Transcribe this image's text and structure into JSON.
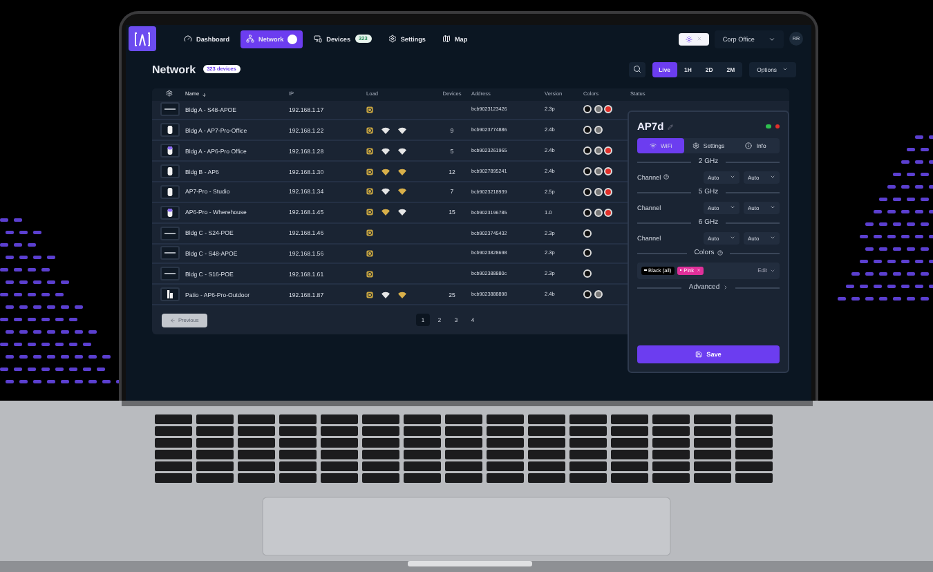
{
  "nav": {
    "items": [
      {
        "label": "Dashboard",
        "selected": false,
        "indicator": false
      },
      {
        "label": "Network",
        "selected": true,
        "indicator": true
      },
      {
        "label": "Devices",
        "selected": false,
        "indicator": false,
        "badge": "323"
      },
      {
        "label": "Settings",
        "selected": false,
        "indicator": false
      },
      {
        "label": "Map",
        "selected": false,
        "indicator": false
      }
    ],
    "theme_toggle": {
      "on": true
    },
    "org": "Corp Office",
    "avatar": "RR"
  },
  "page": {
    "title": "Network",
    "count": "323 devices",
    "ranges": [
      {
        "label": "Live",
        "selected": true
      },
      {
        "label": "1H",
        "selected": false
      },
      {
        "label": "2D",
        "selected": false
      },
      {
        "label": "2M",
        "selected": false
      }
    ],
    "options": "Options"
  },
  "table": {
    "columns": [
      {
        "label": "Name",
        "sorted": true
      },
      {
        "label": "IP",
        "sorted": false
      },
      {
        "label": "Load",
        "sorted": false
      },
      {
        "label": "Devices",
        "sorted": false
      },
      {
        "label": "Address",
        "sorted": false
      },
      {
        "label": "Version",
        "sorted": false
      },
      {
        "label": "Colors",
        "sorted": false
      },
      {
        "label": "Status",
        "sorted": false
      }
    ],
    "rows": [
      {
        "kind": "switch",
        "name": "Bldg A - S48-APOE",
        "ip": "192.168.1.17",
        "bands": [],
        "devices": "",
        "address": "bcb9023123426",
        "version": "2.3p",
        "colors": [
          {
            "color": "#111111"
          },
          {
            "color": "#777777"
          },
          {
            "color": "#e0302a"
          }
        ]
      },
      {
        "kind": "ap",
        "name": "Bldg A - AP7-Pro-Office",
        "ip": "192.168.1.22",
        "bands": [
          {
            "color": "#e6e6e6"
          },
          {
            "color": "#e6e6e6"
          }
        ],
        "devices": "9",
        "address": "bcb9023774886",
        "version": "2.4b",
        "colors": [
          {
            "color": "#111111"
          },
          {
            "color": "#777777"
          }
        ]
      },
      {
        "kind": "ap-accent",
        "name": "Bldg A - AP6-Pro Office",
        "ip": "192.168.1.28",
        "bands": [
          {
            "color": "#e6e6e6"
          },
          {
            "color": "#e6e6e6"
          }
        ],
        "devices": "5",
        "address": "bcb9023261965",
        "version": "2.4b",
        "colors": [
          {
            "color": "#111111"
          },
          {
            "color": "#777777"
          },
          {
            "color": "#e0302a"
          }
        ]
      },
      {
        "kind": "ap",
        "name": "Bldg B - AP6",
        "ip": "192.168.1.30",
        "bands": [
          {
            "color": "#d9b04a"
          },
          {
            "color": "#d9b04a"
          }
        ],
        "devices": "12",
        "address": "bcb9027895241",
        "version": "2.4b",
        "colors": [
          {
            "color": "#111111"
          },
          {
            "color": "#777777"
          },
          {
            "color": "#e0302a"
          }
        ]
      },
      {
        "kind": "ap",
        "name": "AP7-Pro - Studio",
        "ip": "192.168.1.34",
        "bands": [
          {
            "color": "#e6e6e6"
          },
          {
            "color": "#d9b04a"
          }
        ],
        "devices": "7",
        "address": "bcb9023218939",
        "version": "2.5p",
        "colors": [
          {
            "color": "#111111"
          },
          {
            "color": "#777777"
          },
          {
            "color": "#e0302a"
          }
        ]
      },
      {
        "kind": "ap-accent",
        "name": "AP6-Pro - Wherehouse",
        "ip": "192.168.1.45",
        "bands": [
          {
            "color": "#d9b04a"
          },
          {
            "color": "#e6e6e6"
          }
        ],
        "devices": "15",
        "address": "bcb9023196785",
        "version": "1.0",
        "colors": [
          {
            "color": "#111111"
          },
          {
            "color": "#777777"
          },
          {
            "color": "#e0302a"
          }
        ]
      },
      {
        "kind": "switch",
        "name": "Bldg C - S24-POE",
        "ip": "192.168.1.46",
        "bands": [],
        "devices": "",
        "address": "bcb9023745432",
        "version": "2.3p",
        "colors": [
          {
            "color": "#111111"
          }
        ]
      },
      {
        "kind": "switch",
        "name": "Bldg C - S48-APOE",
        "ip": "192.168.1.56",
        "bands": [],
        "devices": "",
        "address": "bcb9023828698",
        "version": "2.3p",
        "colors": [
          {
            "color": "#111111"
          }
        ]
      },
      {
        "kind": "switch",
        "name": "Bldg C - S16-POE",
        "ip": "192.168.1.61",
        "bands": [],
        "devices": "",
        "address": "bcb902388880c",
        "version": "2.3p",
        "colors": [
          {
            "color": "#111111"
          }
        ]
      },
      {
        "kind": "outdoor",
        "name": "Patio - AP6-Pro-Outdoor",
        "ip": "192.168.1.87",
        "bands": [
          {
            "color": "#e6e6e6"
          },
          {
            "color": "#d9b04a"
          }
        ],
        "devices": "25",
        "address": "bcb9023888898",
        "version": "2.4b",
        "colors": [
          {
            "color": "#111111"
          },
          {
            "color": "#777777"
          }
        ]
      }
    ],
    "previous": {
      "label": "Previous",
      "disabled": true
    },
    "pages": [
      {
        "label": "1",
        "selected": true
      },
      {
        "label": "2",
        "selected": false
      },
      {
        "label": "3",
        "selected": false
      },
      {
        "label": "4",
        "selected": false
      }
    ]
  },
  "panel": {
    "title": "AP7d",
    "status": [
      {
        "color": "#2ec04f"
      },
      {
        "color": "#e0302a"
      }
    ],
    "tabs": [
      {
        "label": "WiFi",
        "selected": true
      },
      {
        "label": "Settings",
        "selected": false
      },
      {
        "label": "Info",
        "selected": false
      }
    ],
    "bands": [
      {
        "heading": "2 GHz",
        "label": "Channel",
        "help": true,
        "values": [
          "Auto",
          "Auto"
        ]
      },
      {
        "heading": "5 GHz",
        "label": "Channel",
        "help": false,
        "values": [
          "Auto",
          "Auto"
        ]
      },
      {
        "heading": "6 GHz",
        "label": "Channel",
        "help": false,
        "values": [
          "Auto",
          "Auto"
        ]
      }
    ],
    "colors_heading": "Colors",
    "chips": [
      {
        "label": "Black (all)",
        "color": "#000000",
        "removable": false
      },
      {
        "label": "Pink",
        "color": "#e0309a",
        "removable": true
      }
    ],
    "edit": "Edit",
    "advanced": "Advanced",
    "save": "Save"
  }
}
